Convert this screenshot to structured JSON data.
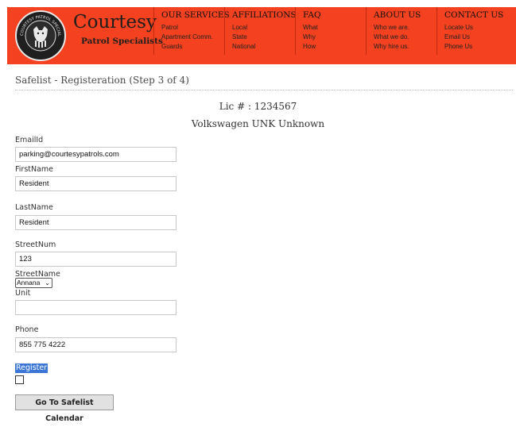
{
  "header": {
    "brand_name": "Courtesy",
    "brand_sub": "Patrol Specialists",
    "logo_text": "COURTESY PATROL SPECIALISTS",
    "colors": {
      "banner": "#f4411f",
      "text": "#1e1e1e"
    },
    "nav": [
      {
        "heading": "OUR SERVICES",
        "items": [
          "Patrol",
          "Apartment Comm.",
          "Guards"
        ]
      },
      {
        "heading": "AFFILIATIONS",
        "items": [
          "Local",
          "State",
          "National"
        ]
      },
      {
        "heading": "FAQ",
        "items": [
          "What",
          "Why",
          "How"
        ]
      },
      {
        "heading": "ABOUT US",
        "items": [
          "Who we are.",
          "What we do.",
          "Why hire us."
        ]
      },
      {
        "heading": "CONTACT US",
        "items": [
          "Locate Us",
          "Email Us",
          "Phone Us"
        ]
      }
    ]
  },
  "page": {
    "title": "Safelist - Registeration (Step 3 of 4)",
    "lic": "Lic # : 1234567",
    "vehicle": "Volkswagen UNK Unknown"
  },
  "form": {
    "email": {
      "label": "EmailId",
      "value": "parking@courtesypatrols.com"
    },
    "first_name": {
      "label": "FirstName",
      "value": "Resident"
    },
    "last_name": {
      "label": "LastName",
      "value": "Resident"
    },
    "street_num": {
      "label": "StreetNum",
      "value": "123"
    },
    "street_name": {
      "label": "StreetName",
      "selected": "Annana",
      "icon": "chevron-down-icon"
    },
    "unit": {
      "label": "Unit",
      "value": ""
    },
    "phone": {
      "label": "Phone",
      "value": "855 775 4222"
    },
    "register_label": "Register",
    "register_checked": false,
    "calendar_button": "Go To Safelist Calendar"
  }
}
